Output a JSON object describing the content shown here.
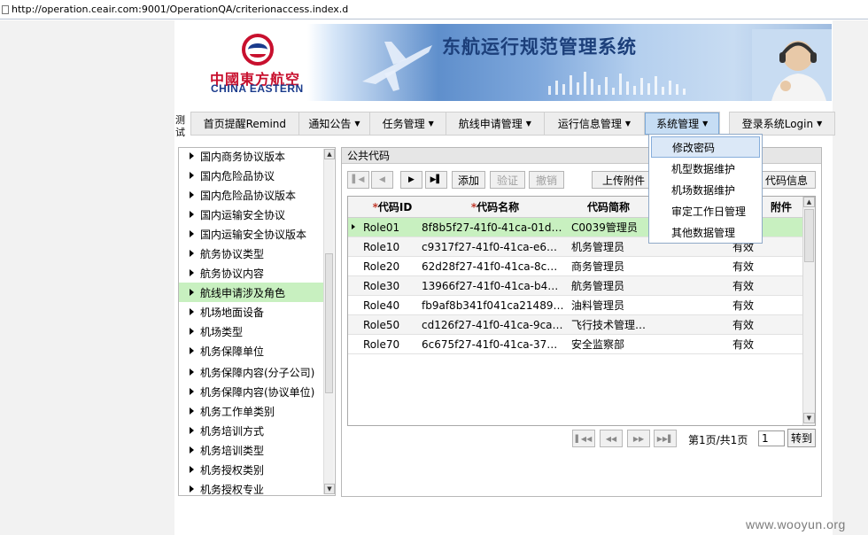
{
  "address_bar": {
    "url": "http://operation.ceair.com:9001/OperationQA/criterionaccess.index.d"
  },
  "banner": {
    "logo_cn": "中國東方航空",
    "logo_en": "CHINA EASTERN",
    "system_title": "东航运行规范管理系统"
  },
  "nav": {
    "side_label": "测试",
    "items": [
      {
        "label": "首页提醒Remind",
        "has_menu": false
      },
      {
        "label": "通知公告",
        "has_menu": true
      },
      {
        "label": "任务管理",
        "has_menu": true
      },
      {
        "label": "航线申请管理",
        "has_menu": true
      },
      {
        "label": "运行信息管理",
        "has_menu": true
      },
      {
        "label": "系统管理",
        "has_menu": true,
        "active": true
      }
    ],
    "login_label": "登录系统Login",
    "caret": "▼"
  },
  "dropdown": {
    "items": [
      "修改密码",
      "机型数据维护",
      "机场数据维护",
      "审定工作日管理",
      "其他数据管理"
    ],
    "highlighted": 0
  },
  "tree": {
    "items": [
      "国内商务协议版本",
      "国内危险品协议",
      "国内危险品协议版本",
      "国内运输安全协议",
      "国内运输安全协议版本",
      "航务协议类型",
      "航务协议内容",
      "航线申请涉及角色",
      "机场地面设备",
      "机场类型",
      "机务保障单位",
      "机务保障内容(分子公司)",
      "机务保障内容(协议单位)",
      "机务工作单类别",
      "机务培训方式",
      "机务培训类型",
      "机务授权类别",
      "机务授权专业"
    ],
    "selected": 7
  },
  "panel": {
    "title": "公共代码",
    "toolbar": {
      "add": "添加",
      "verify": "验证",
      "revoke": "撤销",
      "upload": "上传附件",
      "code_info": "代码信息",
      "first": "▌◀",
      "prev": "◀",
      "next": "▶",
      "last": "▶▌"
    },
    "grid": {
      "columns": [
        "代码ID",
        "代码名称",
        "代码简称",
        "",
        "附件"
      ],
      "required_mark": "*",
      "rows": [
        {
          "id": "Role01",
          "name": "8f8b5f27-41f0-41ca-01d…",
          "short": "C0039管理员",
          "status": ""
        },
        {
          "id": "Role10",
          "name": "c9317f27-41f0-41ca-e6…",
          "short": "机务管理员",
          "status": "有效"
        },
        {
          "id": "Role20",
          "name": "62d28f27-41f0-41ca-8c…",
          "short": "商务管理员",
          "status": "有效"
        },
        {
          "id": "Role30",
          "name": "13966f27-41f0-41ca-b4…",
          "short": "航务管理员",
          "status": "有效"
        },
        {
          "id": "Role40",
          "name": "fb9af8b341f041ca21489…",
          "short": "油料管理员",
          "status": "有效"
        },
        {
          "id": "Role50",
          "name": "cd126f27-41f0-41ca-9ca…",
          "short": "飞行技术管理…",
          "status": "有效"
        },
        {
          "id": "Role70",
          "name": "6c675f27-41f0-41ca-37…",
          "short": "安全监察部",
          "status": "有效"
        }
      ],
      "selected": 0
    },
    "pager": {
      "info": "第1页/共1页",
      "page_value": "1",
      "go": "转到"
    }
  },
  "watermark": "www.wooyun.org",
  "colors": {
    "selected_row": "#c8f0c0",
    "active_nav": "#c6ddf4",
    "brand_red": "#c8102e",
    "brand_blue": "#1a3b8c"
  }
}
